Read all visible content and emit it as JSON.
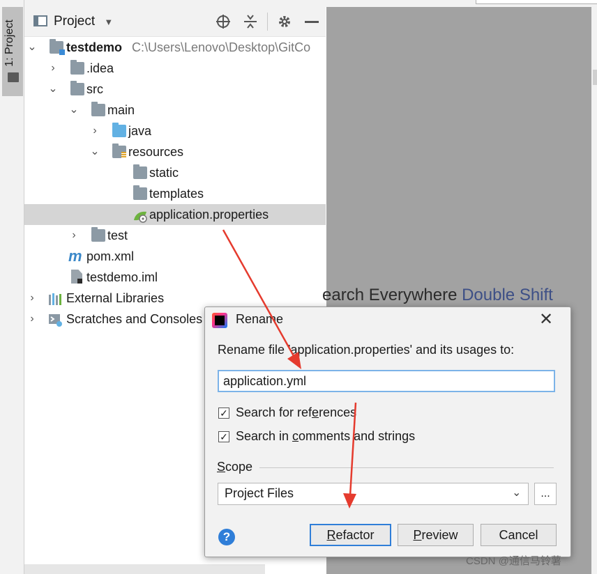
{
  "tool_window": {
    "stripe_label": "1: Project"
  },
  "project_panel": {
    "header_title": "Project",
    "toolbar_icons": [
      "crosshair-icon",
      "collapse-all-icon",
      "gear-icon",
      "minimize-icon"
    ]
  },
  "tree": {
    "items": [
      {
        "label": "testdemo",
        "path": "C:\\Users\\Lenovo\\Desktop\\GitCo"
      },
      {
        "label": ".idea"
      },
      {
        "label": "src"
      },
      {
        "label": "main"
      },
      {
        "label": "java"
      },
      {
        "label": "resources"
      },
      {
        "label": "static"
      },
      {
        "label": "templates"
      },
      {
        "label": "application.properties"
      },
      {
        "label": "test"
      },
      {
        "label": "pom.xml"
      },
      {
        "label": "testdemo.iml"
      },
      {
        "label": "External Libraries"
      },
      {
        "label": "Scratches and Consoles"
      }
    ]
  },
  "editor": {
    "hint_text": "earch Everywhere ",
    "hint_key": "Double Shift"
  },
  "dialog": {
    "title": "Rename",
    "prompt": "Rename file 'application.properties' and its usages to:",
    "input_value": "application.yml",
    "search_references_pre": "Search for ref",
    "search_references_u": "e",
    "search_references_post": "rences",
    "search_references_checked": true,
    "search_comments_pre": "Search in ",
    "search_comments_u": "c",
    "search_comments_post": "omments and strings",
    "search_comments_checked": true,
    "scope_u": "S",
    "scope_rest": "cope",
    "scope_value": "Project Files",
    "scope_more": "...",
    "help": "?",
    "refactor_u": "R",
    "refactor_rest": "efactor",
    "preview_u": "P",
    "preview_rest": "review",
    "cancel": "Cancel"
  },
  "watermark": "CSDN @通信马铃薯",
  "colors": {
    "accent": "#2f7ed8",
    "arrow": "#e53b2e",
    "selection": "#d5d5d5",
    "editor_bg": "#a2a2a2"
  }
}
